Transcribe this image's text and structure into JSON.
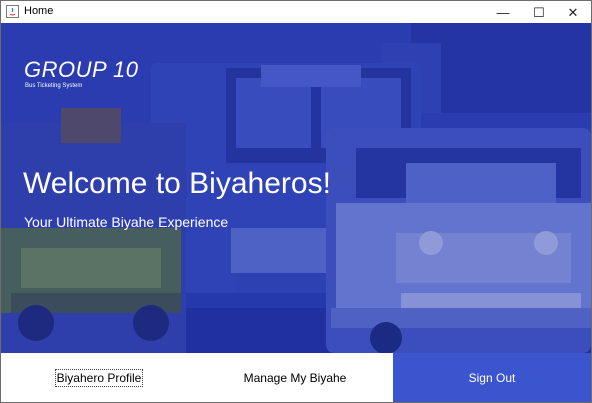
{
  "window": {
    "title": "Home",
    "icon": "java-icon",
    "controls": {
      "minimize": "—",
      "maximize": "☐",
      "close": "✕"
    }
  },
  "hero": {
    "brand": "GROUP 10",
    "brand_subtitle": "Bus Ticketing System",
    "headline": "Welcome to Biyaheros!",
    "tagline": "Your Ultimate Biyahe Experience",
    "overlay_color": "#2b40b5"
  },
  "nav": {
    "profile_label": "Biyahero Profile",
    "trips_label": "Manage My Biyahe",
    "signout_label": "Sign Out",
    "signout_color": "#3b55cf"
  }
}
